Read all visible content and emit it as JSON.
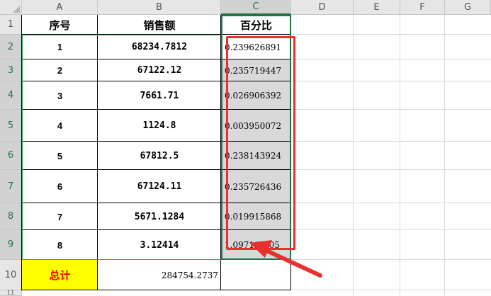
{
  "columns": [
    "A",
    "B",
    "C",
    "D",
    "E",
    "F",
    "G"
  ],
  "rows": [
    "1",
    "2",
    "3",
    "4",
    "5",
    "6",
    "7",
    "8",
    "9",
    "10",
    "11"
  ],
  "headers": {
    "index": "序号",
    "amount": "销售额",
    "percent": "百分比"
  },
  "data_rows": [
    {
      "index": "1",
      "amount": "68234.7812",
      "percent": "0.239626891"
    },
    {
      "index": "2",
      "amount": "67122.12",
      "percent": "0.235719447"
    },
    {
      "index": "3",
      "amount": "7661.71",
      "percent": "0.026906392"
    },
    {
      "index": "4",
      "amount": "1124.8",
      "percent": "0.003950072"
    },
    {
      "index": "5",
      "amount": "67812.5",
      "percent": "0.238143924"
    },
    {
      "index": "6",
      "amount": "67124.11",
      "percent": "0.235726436"
    },
    {
      "index": "7",
      "amount": "5671.1284",
      "percent": "0.019915868"
    },
    {
      "index": "8",
      "amount": "3.12414",
      "percent": "1.09714E-05"
    }
  ],
  "total": {
    "label": "总计",
    "value": "284754.2737"
  },
  "colors": {
    "selection_border": "#217346",
    "annotation_red": "#e8312f",
    "total_fill": "#ffff00",
    "total_text": "#ff0000",
    "selected_fill": "#d9d9d9"
  }
}
